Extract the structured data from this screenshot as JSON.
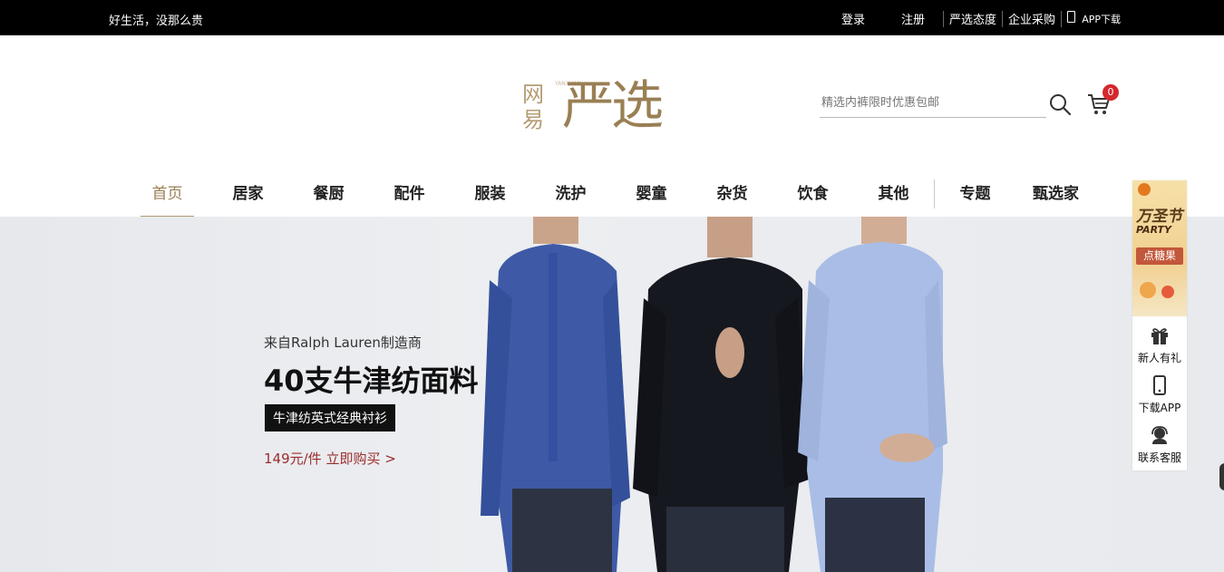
{
  "topbar": {
    "slogan": "好生活，没那么贵",
    "login": "登录",
    "register": "注册",
    "attitude": "严选态度",
    "enterprise": "企业采购",
    "app_download": "APP下载"
  },
  "logo": {
    "wangyi": "网易",
    "yanxuan": "严选",
    "pinyin": "YANXUAN"
  },
  "search": {
    "placeholder": "精选内裤限时优惠包邮",
    "icon": "search-icon"
  },
  "cart": {
    "icon": "cart-icon",
    "count": "0"
  },
  "nav": {
    "items": [
      "首页",
      "居家",
      "餐厨",
      "配件",
      "服装",
      "洗护",
      "婴童",
      "杂货",
      "饮食",
      "其他",
      "专题",
      "甄选家"
    ],
    "active_index": 0
  },
  "banner": {
    "subtitle": "来自Ralph Lauren制造商",
    "title": "40支牛津纺面料",
    "tag": "牛津纺英式经典衬衫",
    "price_link": "149元/件 立即购买 >"
  },
  "side": {
    "promo_title": "万圣节",
    "promo_sub": "PARTY",
    "promo_button": "点糖果",
    "gift": "新人有礼",
    "download": "下载APP",
    "service": "联系客服"
  },
  "colors": {
    "accent": "#b49c74",
    "price_red": "#9b2c2c",
    "badge_red": "#d4282d"
  }
}
